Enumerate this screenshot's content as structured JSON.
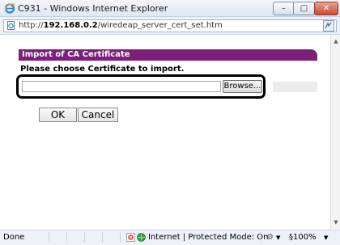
{
  "window": {
    "title": "C931 - Windows Internet Explorer",
    "min_glyph": "–",
    "max_glyph": "□",
    "close_glyph": "✕"
  },
  "address": {
    "prefix": "http://",
    "host": "192.168.0.2",
    "path": "/wiredeap_server_cert_set.htm"
  },
  "page": {
    "section_title": "Import of CA Certificate",
    "instruction": "Please choose Certificate to import.",
    "file_value": "",
    "browse_label": "Browse...",
    "ok_label": "OK",
    "cancel_label": "Cancel",
    "banner_color": "#7b1f7b"
  },
  "status": {
    "text": "Done",
    "zone": "Internet | Protected Mode: On",
    "zoom": "§100%",
    "zoom_caret": "▼",
    "settings_caret": "▼"
  },
  "icons": {
    "browser": "ie-logo-icon",
    "page": "page-icon",
    "compat": "compat-view-icon",
    "protected": "protected-mode-icon",
    "globe": "globe-icon"
  }
}
